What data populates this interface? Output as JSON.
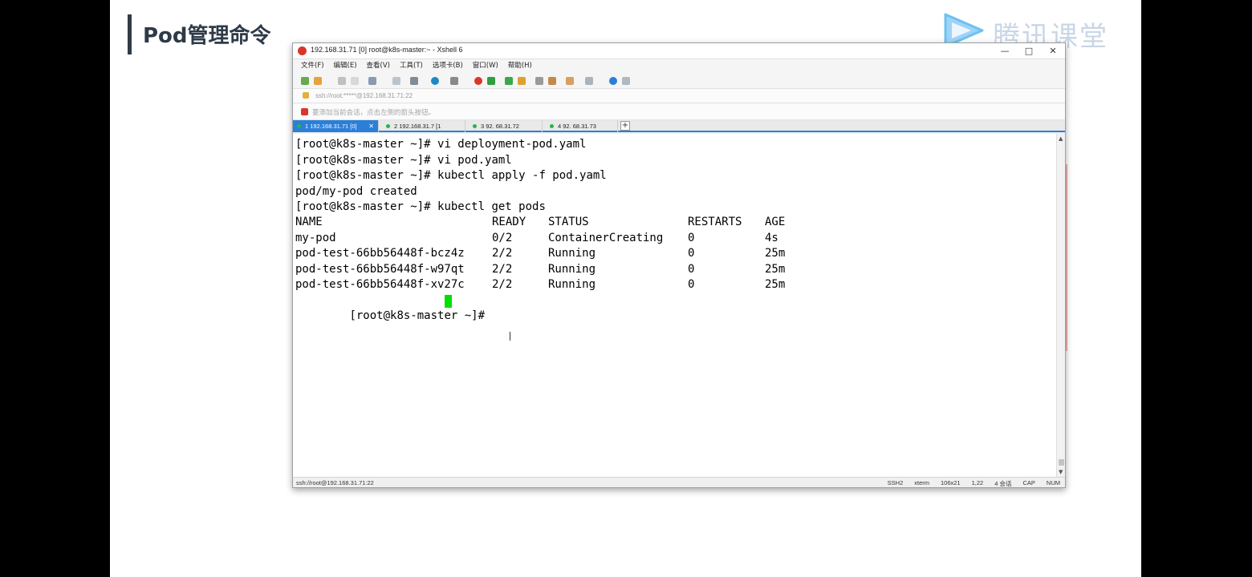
{
  "slide": {
    "title": "Pod管理命令"
  },
  "logo": {
    "text": "腾讯课堂"
  },
  "window": {
    "title": "192.168.31.71 [0]   root@k8s-master:~   -   Xshell 6",
    "controls": [
      "—",
      "□",
      "✕"
    ]
  },
  "menu": [
    "文件(F)",
    "编辑(E)",
    "查看(V)",
    "工具(T)",
    "选项卡(B)",
    "窗口(W)",
    "帮助(H)"
  ],
  "address": "ssh://root:*****@192.168.31.71:22",
  "session_hint": "要添加当前会话，点击左侧的箭头按钮。",
  "tabs": [
    {
      "label": "1 192.168.31.71 [0]",
      "active": true
    },
    {
      "label": "2 192.168.31.7  [1",
      "active": false
    },
    {
      "label": "3  92.  68.31.72",
      "active": false
    },
    {
      "label": "4  92.  68.31.73",
      "active": false
    }
  ],
  "tab_add": "+",
  "terminal": {
    "prompt": "[root@k8s-master ~]# ",
    "cmd1": "vi deployment-pod.yaml",
    "cmd2": "vi pod.yaml",
    "cmd3": "kubectl apply -f pod.yaml",
    "output1": "pod/my-pod created",
    "cmd4": "kubectl get pods",
    "headers": [
      "NAME",
      "READY",
      "STATUS",
      "RESTARTS",
      "AGE"
    ],
    "rows": [
      [
        "my-pod",
        "0/2",
        "ContainerCreating",
        "0",
        "4s"
      ],
      [
        "pod-test-66bb56448f-bcz4z",
        "2/2",
        "Running",
        "0",
        "25m"
      ],
      [
        "pod-test-66bb56448f-w97qt",
        "2/2",
        "Running",
        "0",
        "25m"
      ],
      [
        "pod-test-66bb56448f-xv27c",
        "2/2",
        "Running",
        "0",
        "25m"
      ]
    ]
  },
  "status": {
    "left": "ssh://root@192.168.31.71:22",
    "right": [
      "SSH2",
      "xterm",
      "106x21",
      "1,22",
      "4 会话",
      "CAP",
      "NUM"
    ]
  },
  "colors": {
    "accent": "#2b7fd8",
    "cursor": "#00e000",
    "title": "#2e3a47",
    "logo": "#c9d6e6"
  }
}
